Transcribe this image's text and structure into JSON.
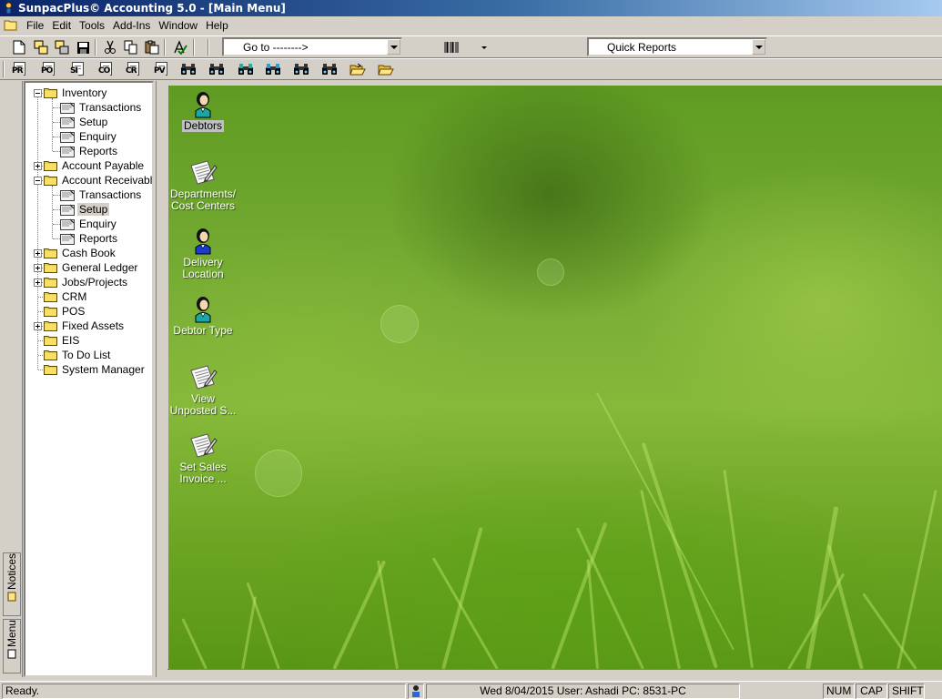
{
  "window": {
    "title": "SunpacPlus© Accounting 5.0 - [Main Menu]"
  },
  "menubar": {
    "items": [
      "File",
      "Edit",
      "Tools",
      "Add-Ins",
      "Window",
      "Help"
    ]
  },
  "toolbar": {
    "goto_value": "Go to -------->",
    "quick_reports_value": "Quick Reports"
  },
  "report_buttons": [
    "PR",
    "PO",
    "SI",
    "CO",
    "CR",
    "PV"
  ],
  "side_tabs": {
    "notices": "Notices",
    "menu": "Menu"
  },
  "tree": [
    {
      "label": "Inventory",
      "level": 0,
      "expander": "minus"
    },
    {
      "label": "Transactions",
      "level": 1
    },
    {
      "label": "Setup",
      "level": 1
    },
    {
      "label": "Enquiry",
      "level": 1
    },
    {
      "label": "Reports",
      "level": 1
    },
    {
      "label": "Account Payable",
      "level": 0,
      "expander": "plus"
    },
    {
      "label": "Account Receivable",
      "level": 0,
      "expander": "minus"
    },
    {
      "label": "Transactions",
      "level": 1
    },
    {
      "label": "Setup",
      "level": 1,
      "selected": true
    },
    {
      "label": "Enquiry",
      "level": 1
    },
    {
      "label": "Reports",
      "level": 1
    },
    {
      "label": "Cash Book",
      "level": 0,
      "expander": "plus"
    },
    {
      "label": "General Ledger",
      "level": 0,
      "expander": "plus"
    },
    {
      "label": "Jobs/Projects",
      "level": 0,
      "expander": "plus"
    },
    {
      "label": "CRM",
      "level": 0
    },
    {
      "label": "POS",
      "level": 0
    },
    {
      "label": "Fixed Assets",
      "level": 0,
      "expander": "plus"
    },
    {
      "label": "EIS",
      "level": 0
    },
    {
      "label": "To Do List",
      "level": 0
    },
    {
      "label": "System Manager",
      "level": 0
    }
  ],
  "desktop_icons": [
    {
      "label": "Debtors",
      "icon": "person-icon",
      "selected": true
    },
    {
      "label": "Departments/\nCost Centers",
      "icon": "document-pencil-icon"
    },
    {
      "label": "Delivery\nLocation",
      "icon": "person-blue-icon"
    },
    {
      "label": "Debtor Type",
      "icon": "person-icon"
    },
    {
      "label": "View\nUnposted S...",
      "icon": "document-pencil-icon"
    },
    {
      "label": "Set Sales\nInvoice ...",
      "icon": "document-pencil-icon"
    }
  ],
  "statusbar": {
    "message": "Ready.",
    "info": "Wed 8/04/2015 User: Ashadi PC: 8531-PC",
    "num": "NUM",
    "cap": "CAP",
    "shift": "SHIFT"
  }
}
